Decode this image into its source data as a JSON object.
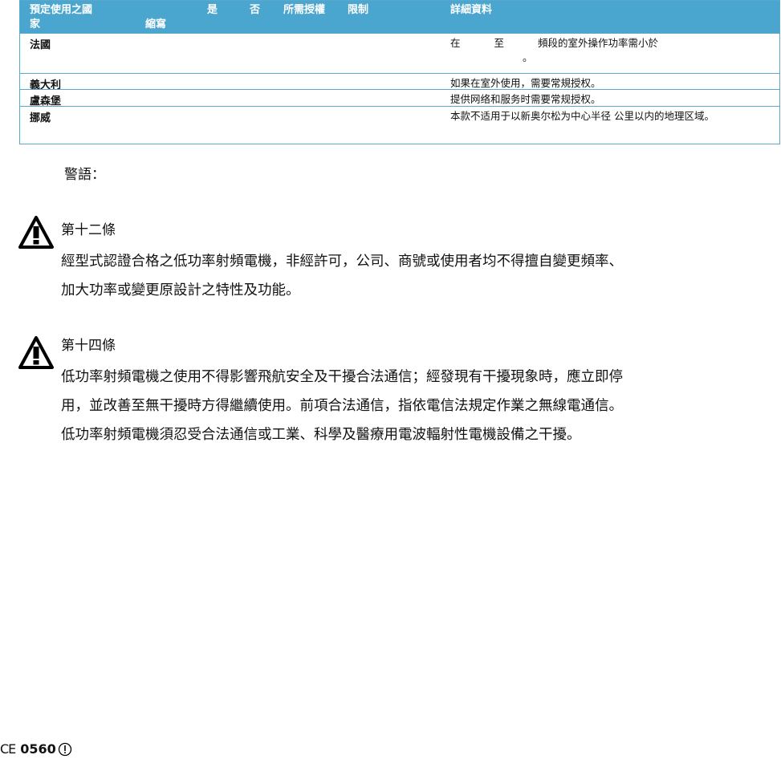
{
  "table": {
    "headers": {
      "country_line1": "預定使用之國",
      "country_line2": "家",
      "abbr": "縮寫",
      "yes": "是",
      "no": "否",
      "license": "所需授權",
      "limit": "限制",
      "detail": "詳細資料"
    },
    "rows": [
      {
        "country": "法國",
        "detail": "在 至 頻段的室外操作功率需小於",
        "detail_sub": "。"
      },
      {
        "country": "義大利",
        "detail": "如果在室外使用，需要常規授权。"
      },
      {
        "country": "盧森堡",
        "detail": "提供网络和服务时需要常规授权。"
      },
      {
        "country": "挪威",
        "detail": "本款不适用于以新奥尔松为中心半径 公里以内的地理区域。"
      }
    ]
  },
  "warnings": {
    "heading": "警語：",
    "articles": [
      {
        "title": "第十二條",
        "lines": [
          "經型式認證合格之低功率射頻電機，非經許可，公司、商號或使用者均不得擅自變更頻率、",
          "加大功率或變更原設計之特性及功能。"
        ]
      },
      {
        "title": "第十四條",
        "lines": [
          "低功率射頻電機之使用不得影響飛航安全及干擾合法通信；經發現有干擾現象時，應立即停",
          "用，並改善至無干擾時方得繼續使用。前項合法通信，指依電信法規定作業之無線電通信。",
          "低功率射頻電機須忍受合法通信或工業、科學及醫療用電波輻射性電機設備之干擾。"
        ]
      }
    ]
  },
  "footer": {
    "ce_mark": "CE",
    "number": "0560"
  }
}
